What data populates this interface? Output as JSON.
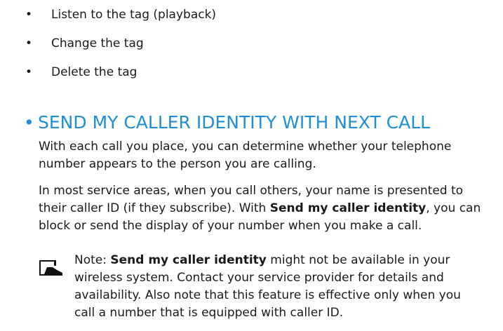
{
  "bullets": [
    "Listen to the tag (playback)",
    "Change the tag",
    "Delete the tag"
  ],
  "bullet_symbol": "•",
  "section": {
    "bullet": "•",
    "heading": "SEND MY CALLER IDENTITY WITH NEXT CALL",
    "heading_color": "#1e8fd6"
  },
  "paragraph1": {
    "line1": "With each call you place, you can determine whether your telephone",
    "line2": "number appears to the person you are calling."
  },
  "paragraph2": {
    "line1": "In most service areas, when you call others, your name is presented to",
    "line2_before": "their caller ID (if they subscribe). With ",
    "line2_bold": "Send my caller identity",
    "line2_after": ", you can",
    "line3": "block or send the display of your number when you make a call."
  },
  "note": {
    "icon": "note-icon",
    "prefix": "Note: ",
    "bold": "Send my caller identity",
    "line1_after": " might not be available in your",
    "line2": "wireless system. Contact your service provider for details and",
    "line3": "availability. Also note that this feature is effective only when you",
    "line4": "call a number that is equipped with caller ID."
  }
}
